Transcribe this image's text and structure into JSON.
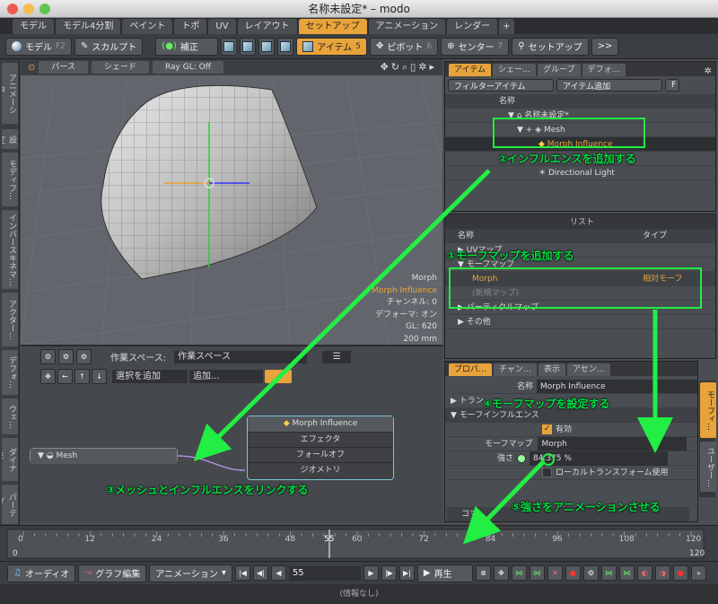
{
  "window": {
    "title": "名称未設定* – modo"
  },
  "layout_tabs": [
    {
      "label": "モデル",
      "active": false
    },
    {
      "label": "モデル4分割",
      "active": false
    },
    {
      "label": "ペイント",
      "active": false
    },
    {
      "label": "トポ",
      "active": false
    },
    {
      "label": "UV",
      "active": false
    },
    {
      "label": "レイアウト",
      "active": false
    },
    {
      "label": "セットアップ",
      "active": true
    },
    {
      "label": "アニメーション",
      "active": false
    },
    {
      "label": "レンダー",
      "active": false
    }
  ],
  "toolbar": {
    "model": "モデル",
    "model_key": "F2",
    "sculpt": "スカルプト",
    "correct": "補正",
    "item": "アイテム",
    "item_key": "5",
    "pivot": "ピボット",
    "pivot_key": "6",
    "center": "センター",
    "center_key": "7",
    "setup": "セットアップ",
    "more": ">>"
  },
  "left_tabs": [
    "アニメーショ…",
    "設定",
    "モディフ…",
    "インバースキネマ…",
    "アクター…",
    "デフォ…",
    "ウェ…",
    "ダイナミ…",
    "パーティ…"
  ],
  "viewport": {
    "mode_perspective": "パース",
    "mode_shade": "シェード",
    "mode_raygl": "Ray GL: Off",
    "info": [
      "Morph",
      "Morph Influence",
      "チャンネル: 0",
      "デフォーマ: オン",
      "GL: 620",
      "200 mm"
    ]
  },
  "schematic": {
    "space_label": "作業スペース:",
    "space_value": "作業スペース",
    "add_selection": "選択を追加",
    "add": "追加...",
    "mesh_node": "Mesh",
    "influence_node": "Morph Influence",
    "rows": [
      "エフェクタ",
      "フォールオフ",
      "ジオメトリ"
    ]
  },
  "items_panel": {
    "tabs": [
      "アイテム",
      "シェー…",
      "グループ",
      "デフォ…"
    ],
    "filter": "フィルターアイテム",
    "add_item": "アイテム追加",
    "f": "F",
    "col_name": "名称",
    "rows": [
      {
        "name": "名称未設定*"
      },
      {
        "name": "Mesh"
      },
      {
        "name": "Morph Influence"
      },
      {
        "name": ""
      },
      {
        "name": "Directional Light"
      }
    ]
  },
  "list_panel": {
    "title": "リスト",
    "col_name": "名称",
    "col_type": "タイプ",
    "rows": [
      {
        "name": "UVマップ",
        "type": ""
      },
      {
        "name": "モーフマップ",
        "type": ""
      },
      {
        "name": "Morph",
        "type": "相対モーフ"
      },
      {
        "name": "(新規マップ)",
        "type": ""
      },
      {
        "name": "パーティクルマップ",
        "type": ""
      },
      {
        "name": "その他",
        "type": ""
      }
    ]
  },
  "props_panel": {
    "tabs": [
      "プロパ…",
      "チャン…",
      "表示",
      "アセン…"
    ],
    "name_label": "名称",
    "name_value": "Morph Influence",
    "transform": "トラン…",
    "section": "モーフインフルエンス",
    "enable": "有効",
    "morph_label": "モーフマップ",
    "morph_value": "Morph",
    "strength_label": "強さ",
    "strength_value": "84.375 %",
    "local": "ローカルトランスフォーム使用",
    "command": "コマ…",
    "side_tab1": "モーフィ…",
    "side_tab2": "ユーザー…"
  },
  "annotations": [
    "②インフルエンスを追加する",
    "①モーフマップを追加する",
    "④モーフマップを設定する",
    "③メッシュとインフルエンスをリンクする",
    "⑤強さをアニメーションさせる"
  ],
  "timeline": {
    "ticks": [
      "0",
      "12",
      "24",
      "36",
      "48",
      "55",
      "60",
      "72",
      "84",
      "96",
      "108",
      "120"
    ],
    "start": "0",
    "end": "120",
    "current": "55"
  },
  "transport": {
    "audio": "オーディオ",
    "graph": "グラフ編集",
    "anim": "アニメーション",
    "frame": "55",
    "play": "再生"
  },
  "status": "(情報なし)"
}
